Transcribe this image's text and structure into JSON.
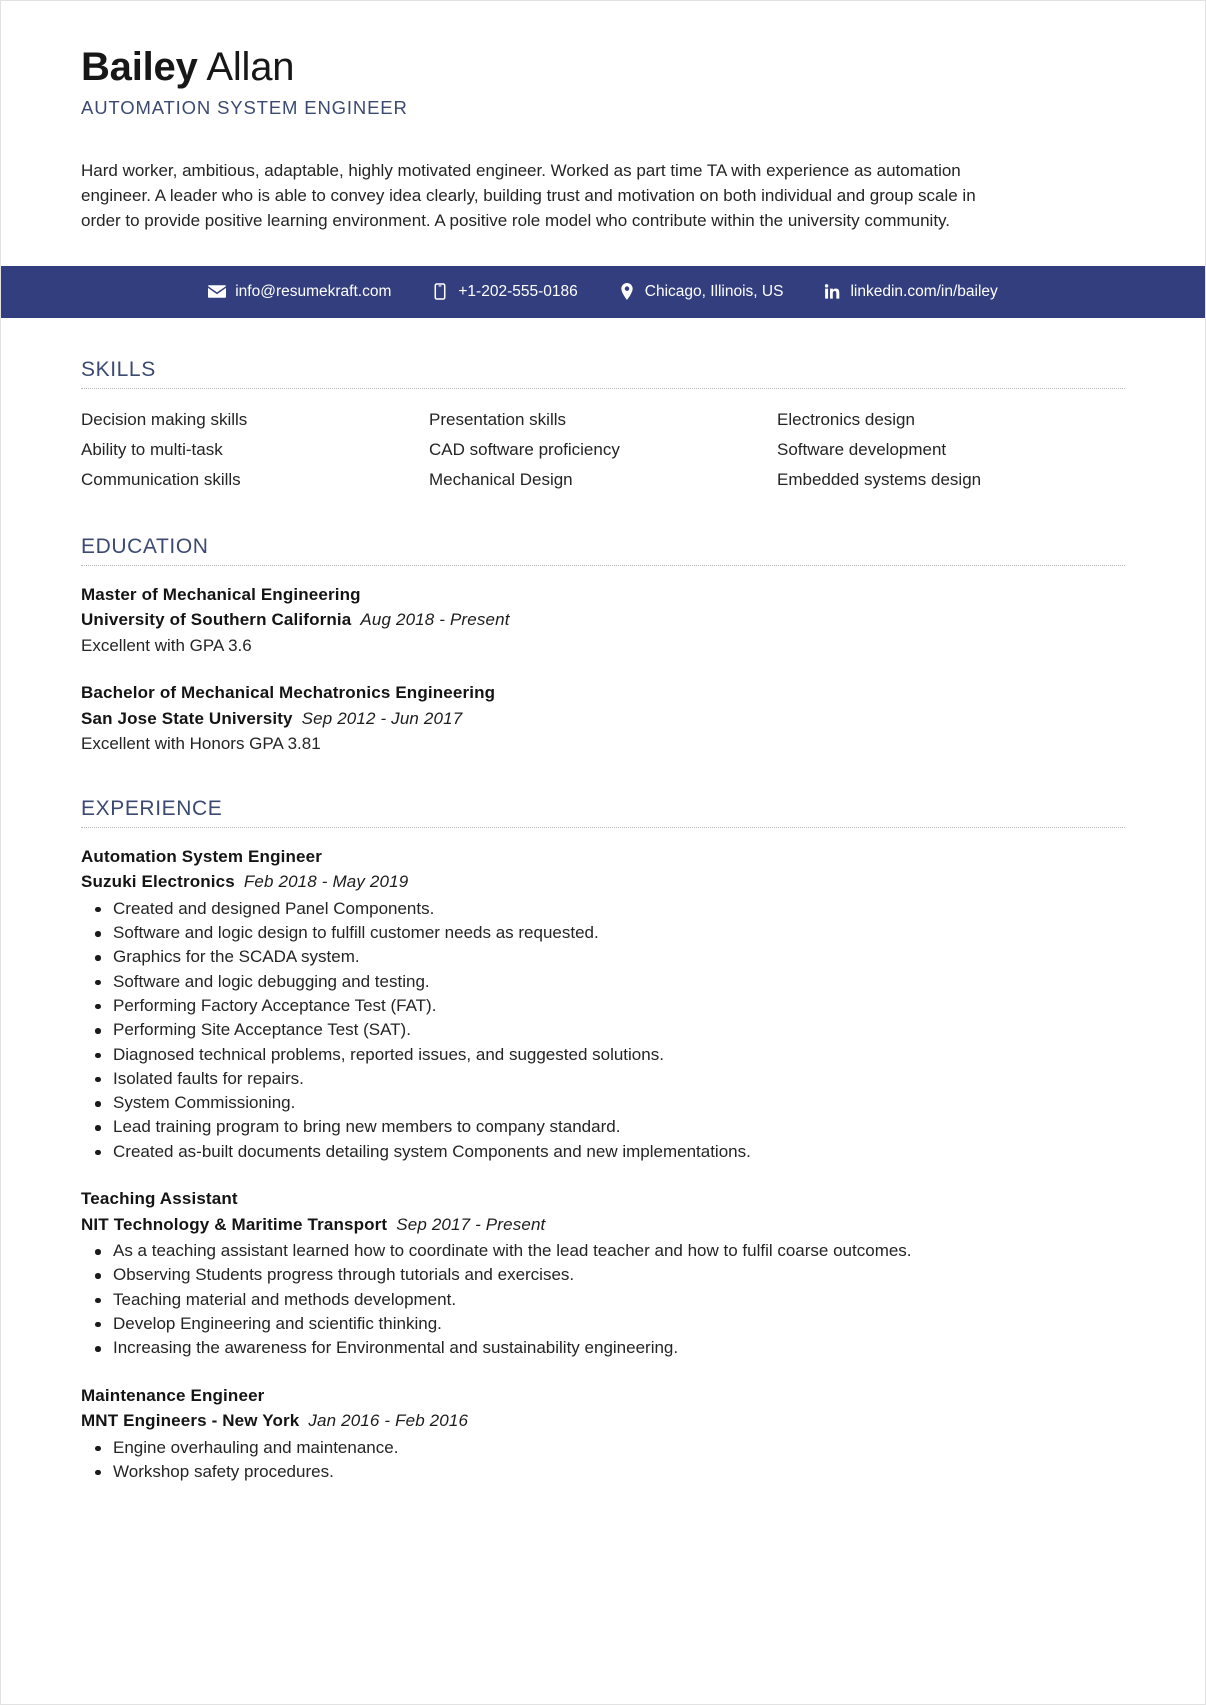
{
  "header": {
    "first_name": "Bailey",
    "last_name": "Allan",
    "job_title": "AUTOMATION SYSTEM ENGINEER"
  },
  "summary": {
    "text": "Hard worker, ambitious, adaptable, highly motivated engineer. Worked as part time TA with experience as automation engineer. A leader who is able to convey idea clearly, building trust and motivation on both individual and group scale in order to provide positive learning environment. A positive role model who contribute within the university community."
  },
  "contact": {
    "bar_color": "#333e7e",
    "email": "info@resumekraft.com",
    "phone": "+1-202-555-0186",
    "location": "Chicago, Illinois, US",
    "linkedin": "linkedin.com/in/bailey"
  },
  "sections": {
    "skills_title": "SKILLS",
    "education_title": "EDUCATION",
    "experience_title": "EXPERIENCE"
  },
  "skills": {
    "column1": [
      "Decision making skills",
      "Ability to multi-task",
      "Communication skills"
    ],
    "column2": [
      "Presentation skills",
      "CAD software proficiency",
      "Mechanical Design"
    ],
    "column3": [
      "Electronics design",
      "Software development",
      "Embedded systems design"
    ]
  },
  "education": [
    {
      "degree": "Master of Mechanical Engineering",
      "school": "University of Southern California",
      "dates": "Aug 2018 - Present",
      "note": "Excellent with GPA 3.6"
    },
    {
      "degree": "Bachelor of Mechanical Mechatronics Engineering",
      "school": "San Jose State University",
      "dates": "Sep 2012 - Jun 2017",
      "note": "Excellent with Honors GPA 3.81"
    }
  ],
  "experience": [
    {
      "role": "Automation System Engineer",
      "company": "Suzuki Electronics",
      "dates": "Feb 2018 - May 2019",
      "bullets": [
        "Created and designed Panel Components.",
        "Software and logic design to fulfill customer needs as requested.",
        "Graphics for the SCADA system.",
        "Software and logic debugging and testing.",
        "Performing Factory Acceptance Test (FAT).",
        "Performing Site Acceptance Test (SAT).",
        "Diagnosed technical problems, reported issues, and suggested solutions.",
        "Isolated faults for repairs.",
        "System Commissioning.",
        "Lead training program to bring new members to company standard.",
        "Created as-built documents detailing system Components and new implementations."
      ]
    },
    {
      "role": "Teaching Assistant",
      "company": "NIT Technology & Maritime Transport",
      "dates": "Sep 2017 - Present",
      "bullets": [
        "As a teaching assistant learned how to coordinate with the lead teacher and how to fulfil coarse outcomes.",
        "Observing Students progress through tutorials and exercises.",
        "Teaching material and methods development.",
        "Develop Engineering and scientific thinking.",
        "Increasing the awareness for Environmental and sustainability engineering."
      ]
    },
    {
      "role": "Maintenance Engineer",
      "company": "MNT Engineers - New York",
      "dates": "Jan 2016 - Feb 2016",
      "bullets": [
        "Engine overhauling and maintenance.",
        "Workshop safety procedures."
      ]
    }
  ]
}
